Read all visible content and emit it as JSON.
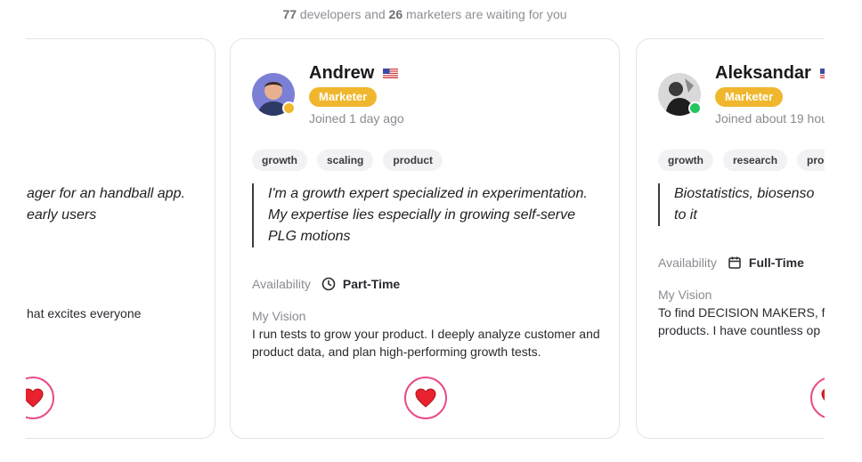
{
  "headline": {
    "developers_count": "77",
    "developers_text": "developers and",
    "marketers_count": "26",
    "marketers_text": "marketers are waiting for you"
  },
  "left_card": {
    "quote_line1": "ager for an handball app.",
    "quote_line2": "early users",
    "vision_fragment": "hat excites everyone"
  },
  "center_card": {
    "name": "Andrew",
    "role": "Marketer",
    "joined": "Joined 1 day ago",
    "tags": [
      "growth",
      "scaling",
      "product"
    ],
    "quote": "I'm a growth expert specialized in experimentation. My expertise lies especially in growing self-serve PLG motions",
    "availability_label": "Availability",
    "availability_value": "Part-Time",
    "availability_icon": "clock-icon",
    "vision_label": "My Vision",
    "vision_text": "I run tests to grow your product. I deeply analyze customer and product data, and plan high-performing growth tests.",
    "status_color": "#f0b72e"
  },
  "right_card": {
    "name": "Aleksandar",
    "role": "Marketer",
    "joined": "Joined about 19 hou",
    "tags": [
      "growth",
      "research",
      "prod"
    ],
    "quote": "Biostatistics, biosenso to it",
    "quote_line1": "Biostatistics, biosenso",
    "quote_line2": "to it",
    "availability_label": "Availability",
    "availability_value": "Full-Time",
    "availability_icon": "calendar-icon",
    "vision_label": "My Vision",
    "vision_line1": "To find DECISION MAKERS, fo",
    "vision_line2": "products. I have countless op",
    "status_color": "#22c55e"
  },
  "colors": {
    "accent_role": "#f0b72e",
    "heart": "#e8222e",
    "like_border": "#e84c8a"
  }
}
